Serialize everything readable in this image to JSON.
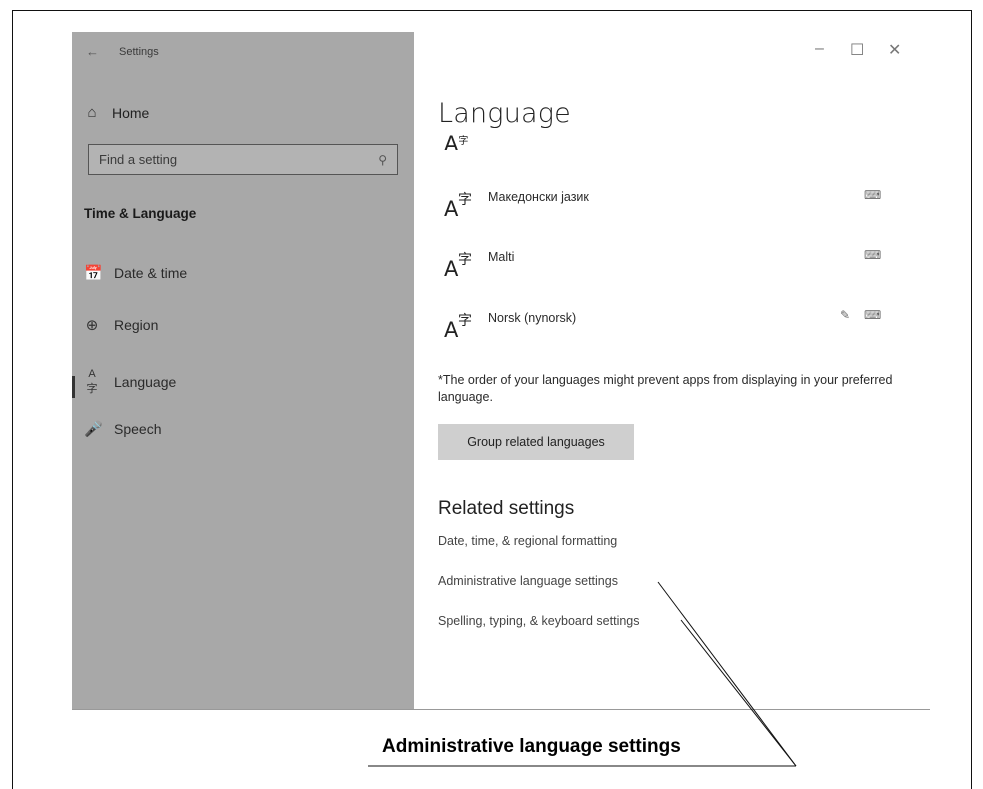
{
  "window": {
    "title": "Settings",
    "controls": {
      "minimize": "–",
      "maximize": "☐",
      "close": "✕"
    }
  },
  "sidebar": {
    "home_label": "Home",
    "search_placeholder": "Find a setting",
    "section_title": "Time & Language",
    "items": [
      {
        "label": "Date & time",
        "icon": "calendar-clock-icon"
      },
      {
        "label": "Region",
        "icon": "globe-icon"
      },
      {
        "label": "Language",
        "icon": "language-icon",
        "active": true
      },
      {
        "label": "Speech",
        "icon": "microphone-icon"
      }
    ]
  },
  "main": {
    "title": "Language",
    "languages": [
      {
        "name": "Македонски јазик",
        "features": [
          "keyboard-icon"
        ]
      },
      {
        "name": "Malti",
        "features": [
          "keyboard-icon"
        ]
      },
      {
        "name": "Norsk (nynorsk)",
        "features": [
          "handwriting-icon",
          "keyboard-icon"
        ]
      }
    ],
    "note": "*The order of your languages might prevent apps from displaying in your preferred language.",
    "group_button": "Group related languages",
    "related_title": "Related settings",
    "related_links": [
      "Date, time, & regional formatting",
      "Administrative language settings",
      "Spelling, typing, & keyboard settings"
    ]
  },
  "callout": {
    "label": "Administrative language settings"
  }
}
